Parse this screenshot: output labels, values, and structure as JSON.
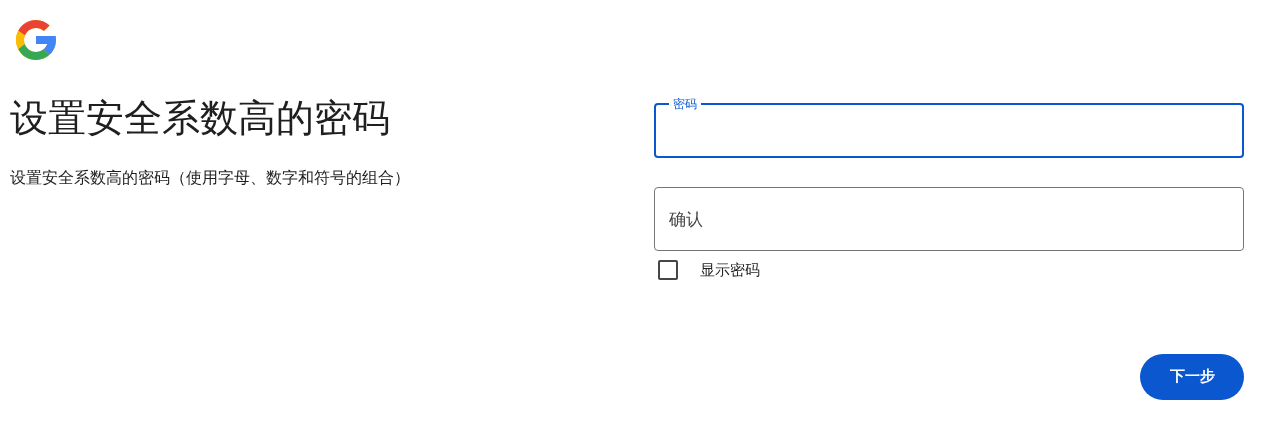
{
  "title": "设置安全系数高的密码",
  "subtitle": "设置安全系数高的密码（使用字母、数字和符号的组合）",
  "fields": [
    {
      "label": "密码",
      "focused": true
    },
    {
      "placeholder": "确认",
      "focused": false
    }
  ],
  "show_password": {
    "label": "显示密码",
    "checked": false
  },
  "next_button": "下一步"
}
